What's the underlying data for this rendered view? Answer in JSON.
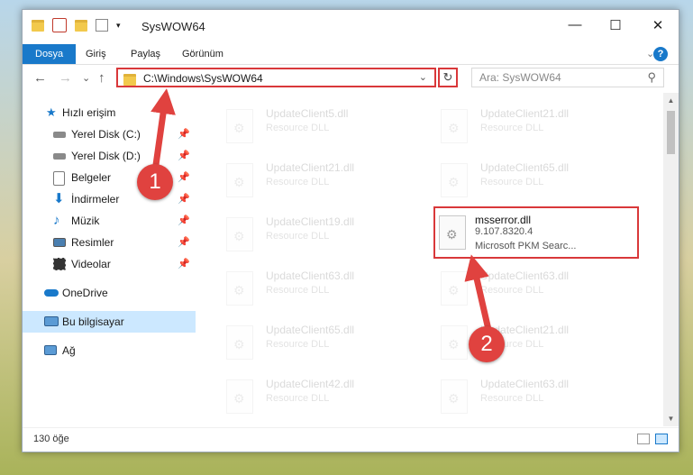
{
  "window": {
    "title": "SysWOW64",
    "minimize": "—",
    "maximize": "☐",
    "close": "✕"
  },
  "ribbon": {
    "tabs": [
      "Dosya",
      "Giriş",
      "Paylaş",
      "Görünüm"
    ],
    "collapse": "⌄",
    "help": "?"
  },
  "navbar": {
    "back": "←",
    "forward": "→",
    "recent": "⌄",
    "up": "↑",
    "address": "C:\\Windows\\SysWOW64",
    "address_dropdown": "⌄",
    "refresh": "↻",
    "search_placeholder": "Ara: SysWOW64",
    "search_icon": "⚲"
  },
  "sidebar": {
    "quick_access": "Hızlı erişim",
    "items": [
      {
        "label": "Yerel Disk (C:)",
        "icon": "drive-icon"
      },
      {
        "label": "Yerel Disk (D:)",
        "icon": "drive-icon"
      },
      {
        "label": "Belgeler",
        "icon": "documents-icon"
      },
      {
        "label": "İndirmeler",
        "icon": "downloads-icon"
      },
      {
        "label": "Müzik",
        "icon": "music-icon"
      },
      {
        "label": "Resimler",
        "icon": "pictures-icon"
      },
      {
        "label": "Videolar",
        "icon": "videos-icon"
      }
    ],
    "onedrive": "OneDrive",
    "this_pc": "Bu bilgisayar",
    "network": "Ağ",
    "pin": "📌"
  },
  "files": [
    {
      "name": "UpdateClient5.dll",
      "desc": "Resource DLL"
    },
    {
      "name": "UpdateClient21.dll",
      "desc": "Resource DLL"
    },
    {
      "name": "UpdateClient21.dll",
      "desc": "Resource DLL"
    },
    {
      "name": "UpdateClient65.dll",
      "desc": "Resource DLL"
    },
    {
      "name": "UpdateClient19.dll",
      "desc": "Resource DLL"
    },
    {
      "name": "msserror.dll",
      "desc": "9.107.8320.4",
      "desc2": "Microsoft PKM Searc..."
    },
    {
      "name": "UpdateClient63.dll",
      "desc": "Resource DLL"
    },
    {
      "name": "UpdateClient63.dll",
      "desc": "Resource DLL"
    },
    {
      "name": "UpdateClient65.dll",
      "desc": "Resource DLL"
    },
    {
      "name": "UpdateClient21.dll",
      "desc": "Resource DLL"
    },
    {
      "name": "UpdateClient42.dll",
      "desc": "Resource DLL"
    },
    {
      "name": "UpdateClient63.dll",
      "desc": "Resource DLL"
    }
  ],
  "status": {
    "count": "130 öğe"
  },
  "annotations": {
    "badge1": "1",
    "badge2": "2",
    "color": "#e0423f"
  }
}
